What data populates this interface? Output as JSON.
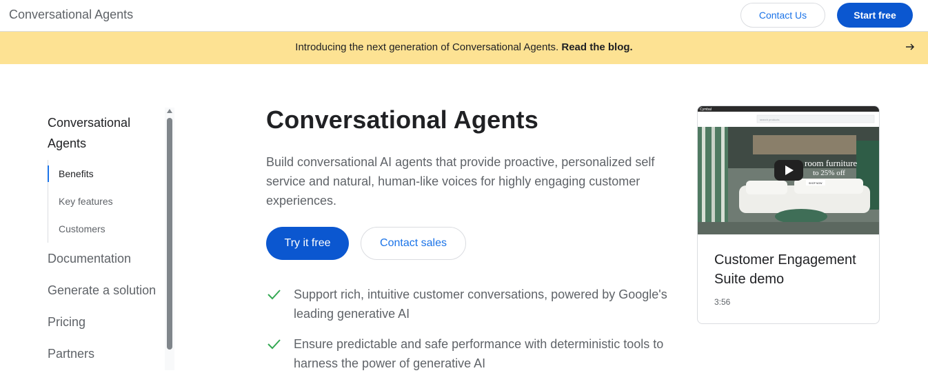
{
  "header": {
    "brand": "Conversational Agents",
    "contact_label": "Contact Us",
    "start_label": "Start free"
  },
  "banner": {
    "text": "Introducing the next generation of Conversational Agents. ",
    "link": "Read the blog.",
    "arrow_icon": "arrow-right-icon"
  },
  "sidebar": {
    "title": "Conversational Agents",
    "subitems": [
      {
        "label": "Benefits",
        "active": true
      },
      {
        "label": "Key features",
        "active": false
      },
      {
        "label": "Customers",
        "active": false
      }
    ],
    "links": [
      "Documentation",
      "Generate a solution",
      "Pricing",
      "Partners"
    ]
  },
  "main": {
    "title": "Conversational Agents",
    "description": "Build conversational AI agents that provide proactive, personalized self service and natural, human-like voices for highly engaging customer experiences.",
    "try_label": "Try it free",
    "contact_sales_label": "Contact sales",
    "features": [
      "Support rich, intuitive customer conversations, powered by Google's leading generative AI",
      "Ensure predictable and safe performance with deterministic tools to harness the power of generative AI"
    ]
  },
  "video": {
    "title": "Customer Engagement Suite demo",
    "duration": "3:56",
    "thumb_brand": "Cymbal",
    "thumb_search": "search products",
    "thumb_headline": "room furniture",
    "thumb_offer": "to 25% off",
    "thumb_cta": "SHOP NOW"
  },
  "colors": {
    "primary": "#0b57d0",
    "link": "#1a73e8",
    "banner": "#fde293",
    "check": "#34a853"
  }
}
